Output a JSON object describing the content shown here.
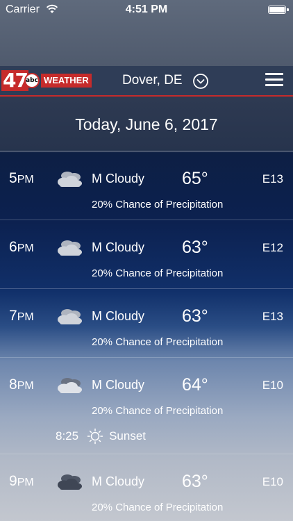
{
  "status_bar": {
    "carrier": "Carrier",
    "time": "4:51 PM"
  },
  "header": {
    "logo": {
      "number": "47",
      "network": "abc",
      "word": "WEATHER"
    },
    "location": "Dover, DE"
  },
  "date_banner": "Today, June 6, 2017",
  "hours": [
    {
      "hour": "5",
      "suffix": "PM",
      "condition": "M Cloudy",
      "temp": "65°",
      "wind": "E13",
      "precip": "20% Chance of Precipitation"
    },
    {
      "hour": "6",
      "suffix": "PM",
      "condition": "M Cloudy",
      "temp": "63°",
      "wind": "E12",
      "precip": "20% Chance of Precipitation"
    },
    {
      "hour": "7",
      "suffix": "PM",
      "condition": "M Cloudy",
      "temp": "63°",
      "wind": "E13",
      "precip": "20% Chance of Precipitation"
    },
    {
      "hour": "8",
      "suffix": "PM",
      "condition": "M Cloudy",
      "temp": "64°",
      "wind": "E10",
      "precip": "20% Chance of Precipitation"
    },
    {
      "hour": "9",
      "suffix": "PM",
      "condition": "M Cloudy",
      "temp": "63°",
      "wind": "E10",
      "precip": "20% Chance of Precipitation"
    }
  ],
  "sunset": {
    "time": "8:25",
    "label": "Sunset"
  },
  "colors": {
    "brand_red": "#c62b2b",
    "header_bg": "#2f3d57"
  }
}
